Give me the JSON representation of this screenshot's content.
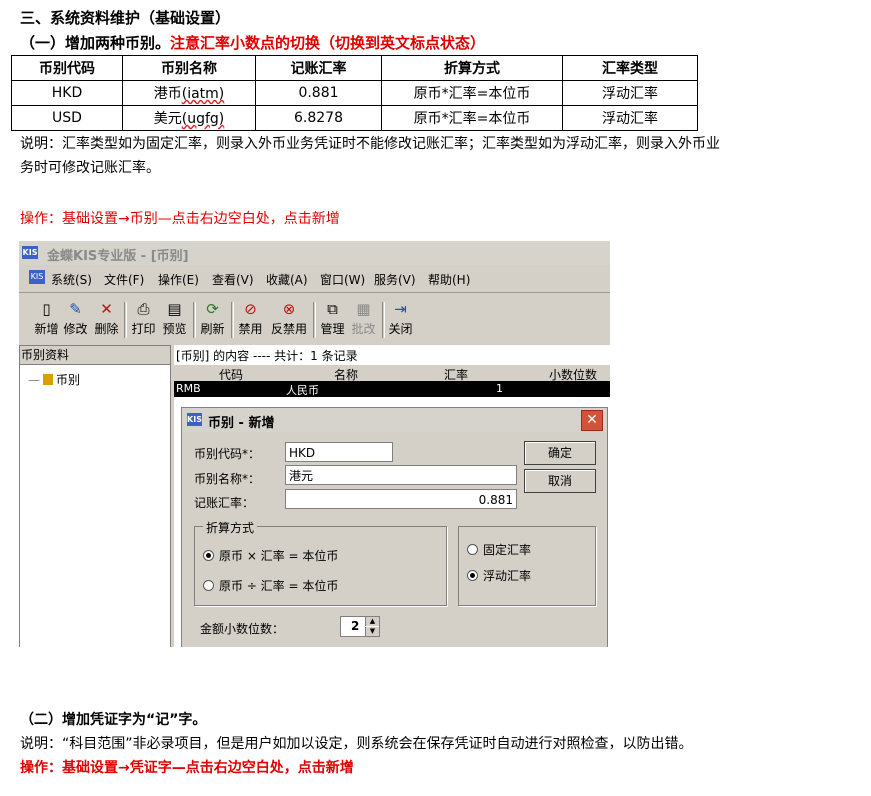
{
  "section3_heading": "三、系统资料维护（基础设置）",
  "sub1_heading_black": "（一）增加两种币别。",
  "sub1_heading_red": "注意汇率小数点的切换（切换到英文标点状态）",
  "table": {
    "headers": [
      "币别代码",
      "币别名称",
      "记账汇率",
      "折算方式",
      "汇率类型"
    ],
    "rows": [
      {
        "code": "HKD",
        "name": "港币",
        "name_suffix": "(iatm)",
        "rate": "0.881",
        "method": "原币*汇率=本位币",
        "type": "浮动汇率"
      },
      {
        "code": "USD",
        "name": "美元",
        "name_suffix": "(ugfg)",
        "rate": "6.8278",
        "method": "原币*汇率=本位币",
        "type": "浮动汇率"
      }
    ]
  },
  "note1_line1": "说明：汇率类型如为固定汇率，则录入外币业务凭证时不能修改记账汇率；汇率类型如为浮动汇率，则录入外币业",
  "note1_line2": "务时可修改记账汇率。",
  "operation1": "操作：基础设置→币别—点击右边空白处，点击新增",
  "app": {
    "logo": "KIS",
    "title": "金蝶KIS专业版 - [币别]",
    "menu": [
      "系统(S)",
      "文件(F)",
      "操作(E)",
      "查看(V)",
      "收藏(A)",
      "窗口(W)",
      "服务(V)",
      "帮助(H)"
    ],
    "toolbar": [
      "新增",
      "修改",
      "删除",
      "打印",
      "预览",
      "刷新",
      "禁用",
      "反禁用",
      "管理",
      "批改",
      "关闭"
    ],
    "tree_header": "币别资料",
    "tree_item": "币别",
    "list_caption": "[币别] 的内容 ---- 共计：1 条记录",
    "grid_headers": [
      "代码",
      "名称",
      "汇率",
      "小数位数"
    ],
    "grid_row": {
      "code": "RMB",
      "name": "人民币",
      "rate": "1"
    },
    "dialog": {
      "title": "币别 - 新增",
      "code_label": "币别代码*：",
      "code_value": "HKD",
      "name_label": "币别名称*：",
      "name_value": "港元",
      "rate_label": "记账汇率：",
      "rate_value": "0.881",
      "ok": "确定",
      "cancel": "取消",
      "method_group": "折算方式",
      "method_opt1": "原币 × 汇率 = 本位币",
      "method_opt2": "原币 ÷ 汇率 = 本位币",
      "type_opt1": "固定汇率",
      "type_opt2": "浮动汇率",
      "decimals_label": "金额小数位数：",
      "decimals_value": "2"
    }
  },
  "sub2_heading": "（二）增加凭证字为“记”字。",
  "note2": "说明：“科目范围”非必录项目，但是用户如加以设定，则系统会在保存凭证时自动进行对照检查，以防出错。",
  "operation2": "操作：基础设置→凭证字—点击右边空白处，点击新增"
}
